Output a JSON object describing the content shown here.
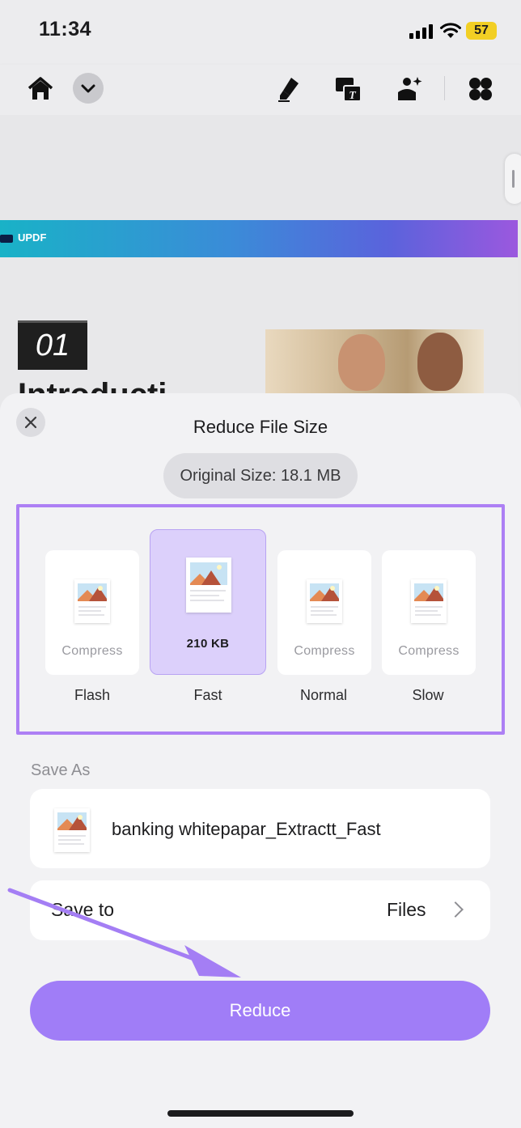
{
  "status_bar": {
    "time": "11:34",
    "battery": "57",
    "battery_color": "#f2cf24"
  },
  "toolbar": {
    "icons": [
      "home-icon",
      "chevron-down-icon",
      "highlighter-icon",
      "ocr-text-icon",
      "ai-image-icon",
      "apps-grid-icon"
    ]
  },
  "document": {
    "banner_logo": "UPDF",
    "banner_gradient": [
      "#19b2c7",
      "#5a63dc",
      "#9b58de"
    ],
    "section_number": "01",
    "heading_partial": "Introducti"
  },
  "dialog": {
    "title": "Reduce File Size",
    "original_size": "Original Size: 18.1 MB",
    "options": [
      {
        "label": "Flash",
        "sub": "Compress",
        "selected": false
      },
      {
        "label": "Fast",
        "sub": "210 KB",
        "selected": true
      },
      {
        "label": "Normal",
        "sub": "Compress",
        "selected": false
      },
      {
        "label": "Slow",
        "sub": "Compress",
        "selected": false
      }
    ],
    "save_as_label": "Save As",
    "file_name": "banking whitepapar_Extractt_Fast",
    "save_to_label": "Save to",
    "save_to_value": "Files",
    "reduce_label": "Reduce",
    "accent_color": "#a07df7",
    "highlight_frame_color": "#ad80f4"
  }
}
